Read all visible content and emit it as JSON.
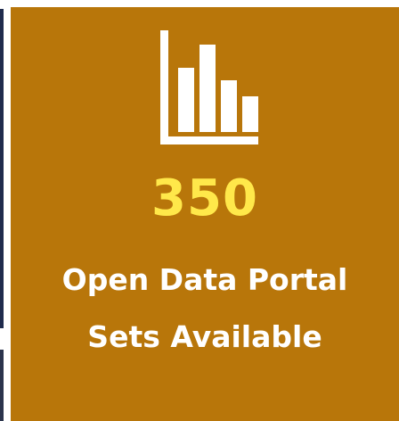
{
  "stat_tile": {
    "icon": "bar-chart-icon",
    "value": "350",
    "label_line1": "Open Data Portal",
    "label_line2": "Sets Available"
  },
  "colors": {
    "tile_background": "#b8760a",
    "value_text": "#ffe84a",
    "label_text": "#ffffff",
    "icon": "#ffffff",
    "edge_strip": "#1f2b4d"
  }
}
